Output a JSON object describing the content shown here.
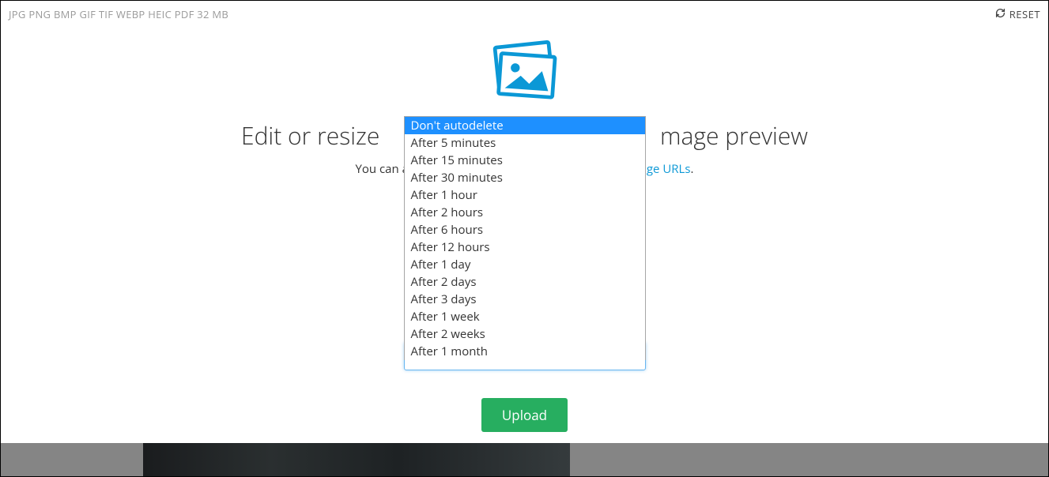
{
  "topbar": {
    "formats": "JPG PNG BMP GIF TIF WEBP HEIC PDF   32 MB",
    "reset_label": "RESET"
  },
  "main": {
    "heading_left": "Edit or resize ",
    "heading_right": "mage preview",
    "subtext_left": "You can a",
    "subtext_mid": "age URLs",
    "subtext_end": "."
  },
  "dropdown": {
    "selected_value": "Don't autodelete",
    "selected_index": 0,
    "options": [
      "Don't autodelete",
      "After 5 minutes",
      "After 15 minutes",
      "After 30 minutes",
      "After 1 hour",
      "After 2 hours",
      "After 6 hours",
      "After 12 hours",
      "After 1 day",
      "After 2 days",
      "After 3 days",
      "After 1 week",
      "After 2 weeks",
      "After 1 month"
    ]
  },
  "upload": {
    "button_label": "Upload"
  },
  "colors": {
    "accent": "#0b98d6",
    "upload_bg": "#27ae60",
    "selection_bg": "#1e90ff"
  }
}
